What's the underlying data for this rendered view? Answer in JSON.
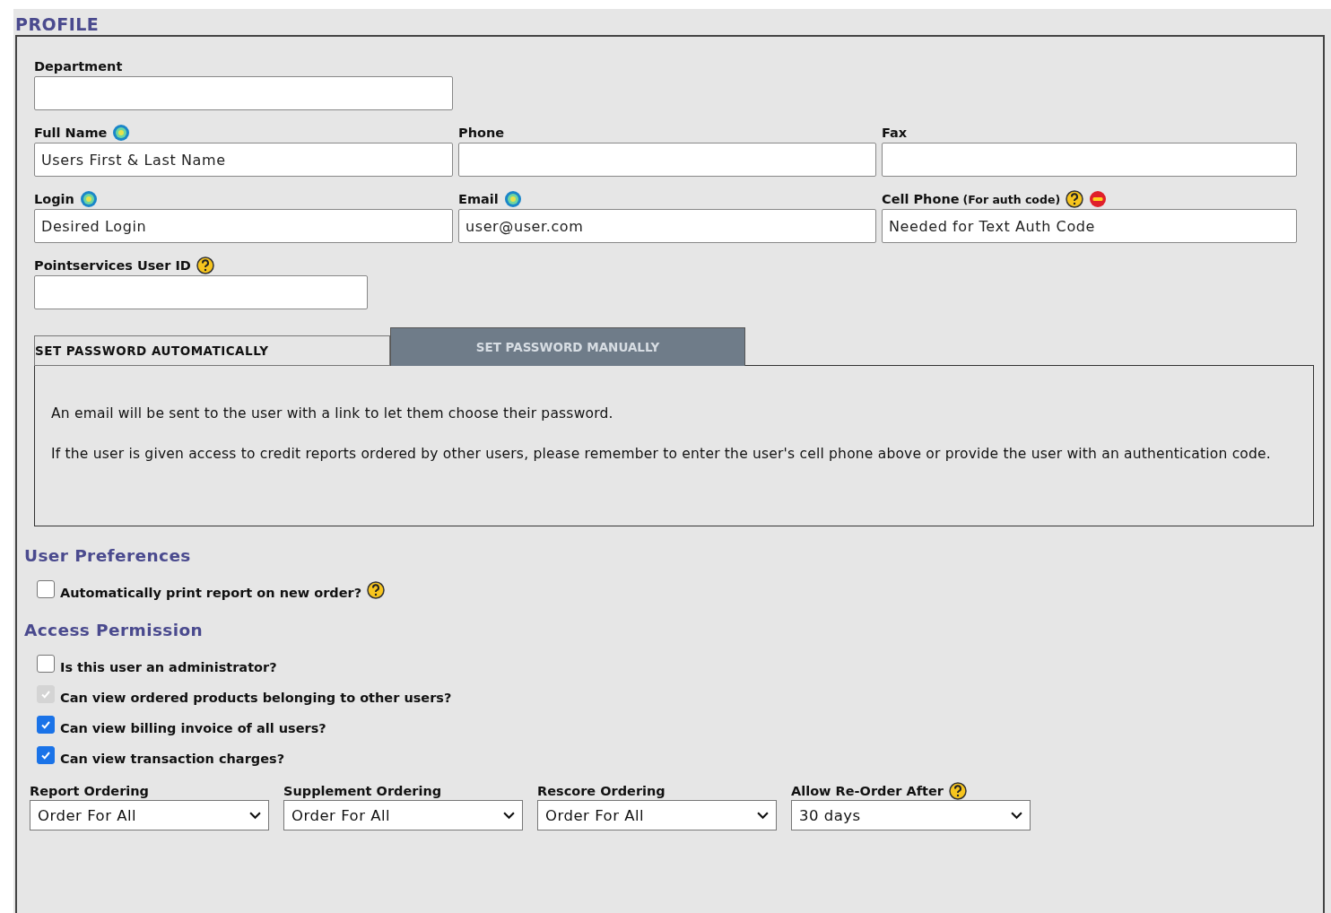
{
  "section_title": "PROFILE",
  "fields": [
    {
      "label": "Department"
    },
    {
      "label": "Full Name",
      "icons": [
        {
          "kind": "required"
        }
      ],
      "placeholder": "Users First & Last Name"
    },
    {
      "label": "Phone"
    },
    {
      "label": "Fax"
    },
    {
      "label": "Login",
      "icons": [
        {
          "kind": "required"
        }
      ],
      "placeholder": "Desired Login"
    },
    {
      "label": "Email",
      "icons": [
        {
          "kind": "required"
        }
      ],
      "placeholder": "user@user.com"
    },
    {
      "label": "Cell Phone",
      "note": "(For auth code)",
      "icons": [
        {
          "kind": "help"
        },
        {
          "kind": "remove"
        }
      ],
      "placeholder": "Needed for Text Auth Code"
    },
    {
      "label": "Pointservices User ID",
      "icons": [
        {
          "kind": "help"
        }
      ]
    }
  ],
  "password_tabs": [
    {
      "label": "SET PASSWORD AUTOMATICALLY",
      "selected": true
    },
    {
      "label": "SET PASSWORD MANUALLY",
      "selected": false
    }
  ],
  "password_text": [
    "An email will be sent to the user with a link to let them choose their password.",
    "If the user is given access to credit reports ordered by other users, please remember to enter the user's cell phone above or provide the user with an authentication code."
  ],
  "user_preferences": {
    "title": "User Preferences",
    "options": [
      {
        "label": "Automatically print report on new order?",
        "checked": false,
        "disabled": false,
        "help": true
      }
    ]
  },
  "access_permission": {
    "title": "Access Permission",
    "options": [
      {
        "label": "Is this user an administrator?",
        "checked": false,
        "disabled": false
      },
      {
        "label": "Can view ordered products belonging to other users?",
        "checked": true,
        "disabled": true
      },
      {
        "label": "Can view billing invoice of all users?",
        "checked": true,
        "disabled": false
      },
      {
        "label": "Can view transaction charges?",
        "checked": true,
        "disabled": false
      }
    ]
  },
  "selects": [
    {
      "label": "Report Ordering",
      "value": "Order For All",
      "help": false
    },
    {
      "label": "Supplement Ordering",
      "value": "Order For All",
      "help": false
    },
    {
      "label": "Rescore Ordering",
      "value": "Order For All",
      "help": false
    },
    {
      "label": "Allow Re-Order After",
      "value": "30 days",
      "help": true
    }
  ]
}
